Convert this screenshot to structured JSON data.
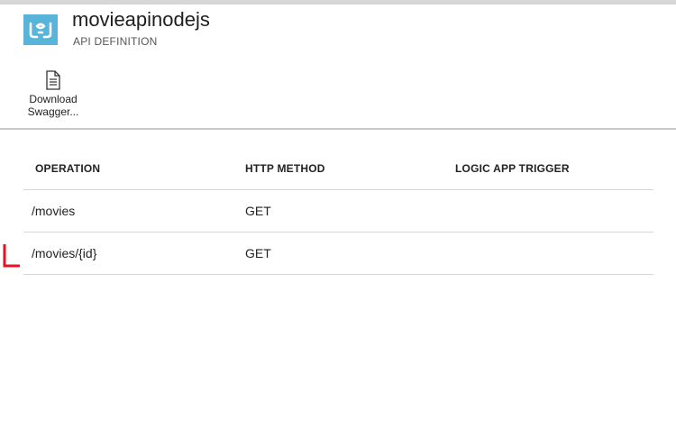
{
  "header": {
    "title": "movieapinodejs",
    "subtitle": "API DEFINITION",
    "icon": "api-app-icon",
    "icon_color": "#59b4d9"
  },
  "toolbar": {
    "download": {
      "label_line1": "Download",
      "label_line2": "Swagger...",
      "icon": "document-icon"
    }
  },
  "table": {
    "columns": [
      "OPERATION",
      "HTTP METHOD",
      "LOGIC APP TRIGGER"
    ],
    "rows": [
      {
        "operation": "/movies",
        "method": "GET",
        "trigger": ""
      },
      {
        "operation": "/movies/{id}",
        "method": "GET",
        "trigger": ""
      }
    ]
  },
  "annotation": {
    "color": "#e81123",
    "icon": "highlight-bracket"
  }
}
